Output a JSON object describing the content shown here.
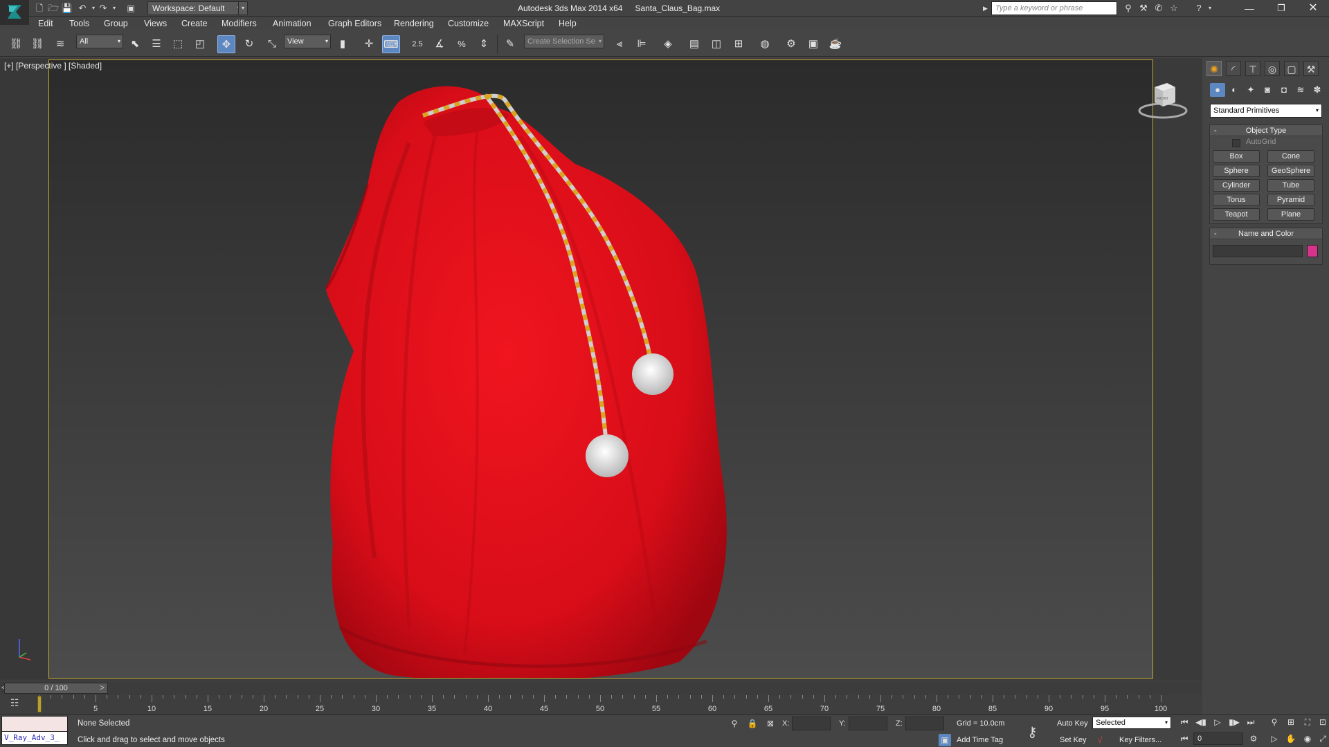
{
  "title_bar": {
    "app_name": "Autodesk 3ds Max  2014 x64",
    "file_name": "Santa_Claus_Bag.max",
    "workspace": "Workspace: Default",
    "search_placeholder": "Type a keyword or phrase"
  },
  "menu": [
    "Edit",
    "Tools",
    "Group",
    "Views",
    "Create",
    "Modifiers",
    "Animation",
    "Graph Editors",
    "Rendering",
    "Customize",
    "MAXScript",
    "Help"
  ],
  "toolbar": {
    "selection_filter": "All",
    "reference_coord": "View",
    "snap_angle_label": "2.5",
    "named_selection_placeholder": "Create Selection Se"
  },
  "viewport": {
    "label": "[+] [Perspective ] [Shaded]",
    "viewcube_face": "FRONT",
    "border_color": "#c9a832",
    "bag_color": "#e8111c",
    "rope_colors": [
      "#c8c8c8",
      "#d6a928"
    ]
  },
  "command_panel": {
    "category": "Standard Primitives",
    "object_type_title": "Object Type",
    "autogrid": "AutoGrid",
    "buttons": [
      "Box",
      "Cone",
      "Sphere",
      "GeoSphere",
      "Cylinder",
      "Tube",
      "Torus",
      "Pyramid",
      "Teapot",
      "Plane"
    ],
    "name_color_title": "Name and Color",
    "object_color": "#d6338c"
  },
  "timeline": {
    "current": "0 / 100",
    "ticks": [
      5,
      10,
      15,
      20,
      25,
      30,
      35,
      40,
      45,
      50,
      55,
      60,
      65,
      70,
      75,
      80,
      85,
      90,
      95,
      100
    ]
  },
  "status": {
    "maxscript_line": "V_Ray_Adv_3_",
    "selection": "None Selected",
    "prompt": "Click and drag to select and move objects",
    "x_label": "X:",
    "y_label": "Y:",
    "z_label": "Z:",
    "grid": "Grid = 10.0cm",
    "add_time_tag": "Add Time Tag",
    "auto_key": "Auto Key",
    "set_key": "Set Key",
    "key_mode": "Selected",
    "key_filters": "Key Filters...",
    "frame": "0"
  }
}
